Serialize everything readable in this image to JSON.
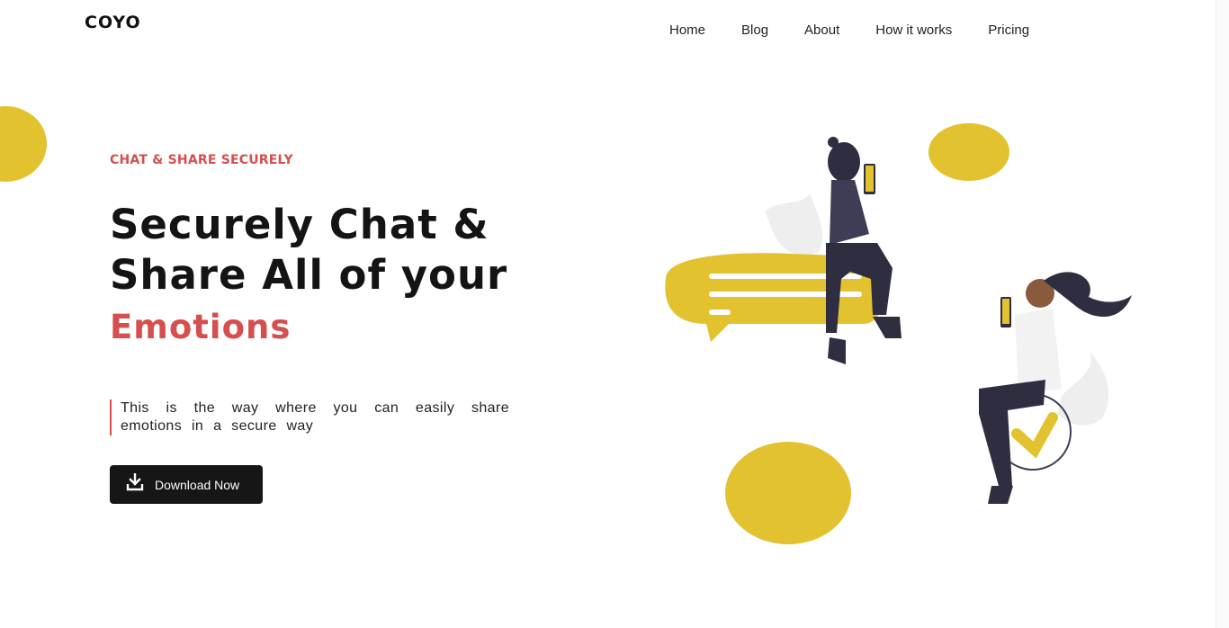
{
  "header": {
    "brand": "COYO",
    "nav": [
      {
        "label": "Home"
      },
      {
        "label": "Blog"
      },
      {
        "label": "About"
      },
      {
        "label": "How it works"
      },
      {
        "label": "Pricing"
      }
    ]
  },
  "hero": {
    "eyebrow": "CHAT & SHARE SECURELY",
    "headline_line1": "Securely Chat &",
    "headline_line2": "Share All of your",
    "headline_accent": "Emotions",
    "description": "This is the way where you can easily share emotions in a secure way",
    "cta_label": "Download Now",
    "cta_icon": "download-icon"
  },
  "colors": {
    "accent": "#d64e4e",
    "yellow": "#e2c22f",
    "dark": "#161616",
    "figure": "#2f2e41"
  }
}
